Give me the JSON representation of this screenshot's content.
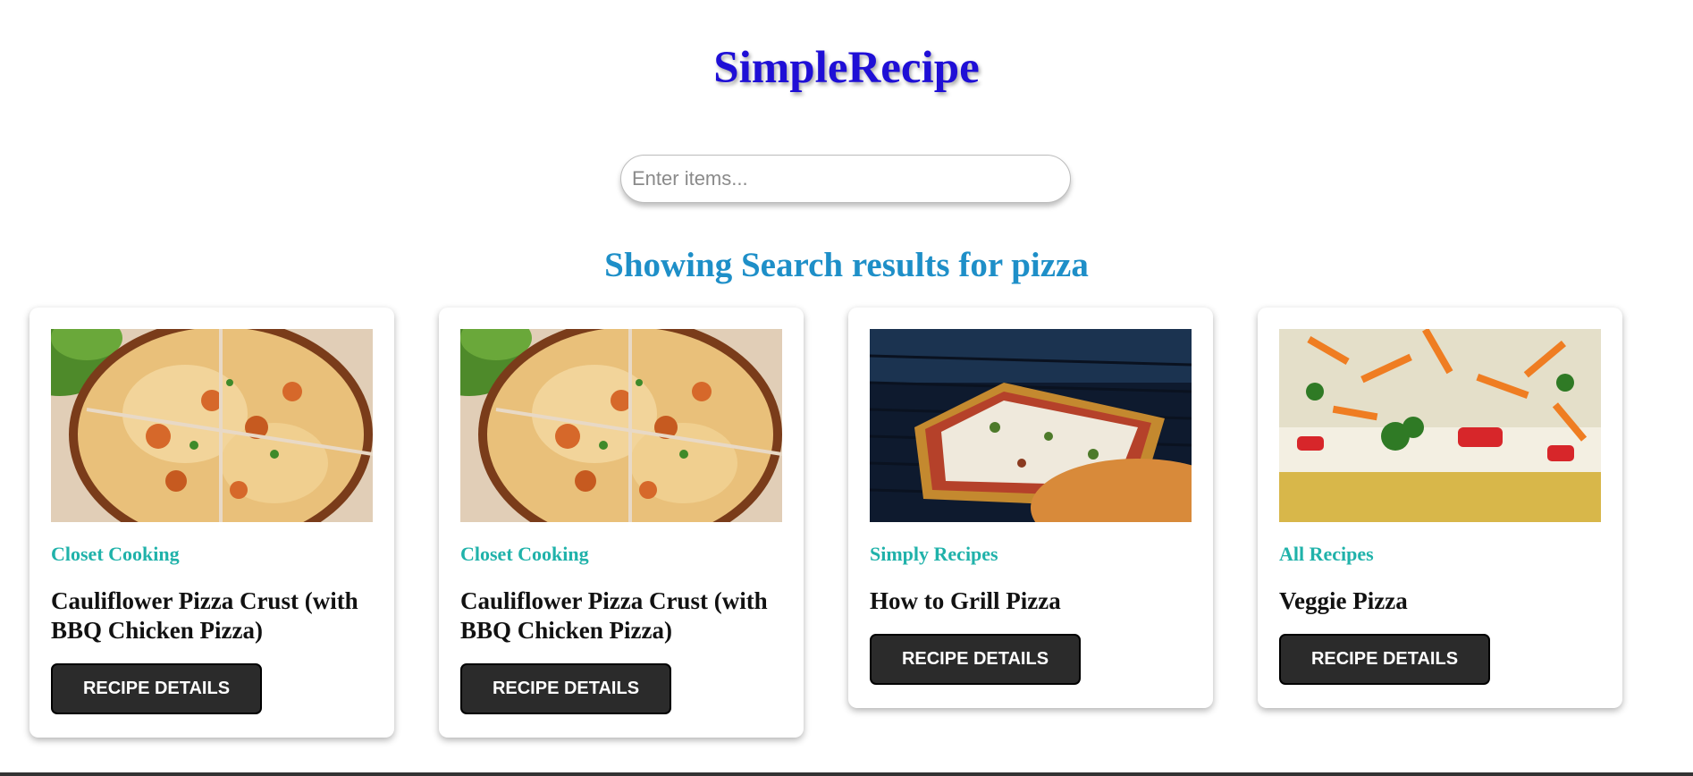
{
  "header": {
    "title": "SimpleRecipe"
  },
  "search": {
    "placeholder": "Enter items...",
    "value": ""
  },
  "results": {
    "heading": "Showing Search results for pizza"
  },
  "cards": [
    {
      "source": "Closet Cooking",
      "title": "Cauliflower Pizza Crust (with BBQ Chicken Pizza)",
      "button_label": "RECIPE DETAILS",
      "image": "cauliflower-bbq-chicken-pizza-photo"
    },
    {
      "source": "Closet Cooking",
      "title": "Cauliflower Pizza Crust (with BBQ Chicken Pizza)",
      "button_label": "RECIPE DETAILS",
      "image": "cauliflower-bbq-chicken-pizza-photo"
    },
    {
      "source": "Simply Recipes",
      "title": "How to Grill Pizza",
      "button_label": "RECIPE DETAILS",
      "image": "grilled-pizza-photo"
    },
    {
      "source": "All Recipes",
      "title": "Veggie Pizza",
      "button_label": "RECIPE DETAILS",
      "image": "veggie-pizza-photo"
    }
  ],
  "colors": {
    "title": "#1f0fd6",
    "heading": "#1e8fc8",
    "source": "#20b2aa",
    "button_bg": "#2b2b2b"
  }
}
